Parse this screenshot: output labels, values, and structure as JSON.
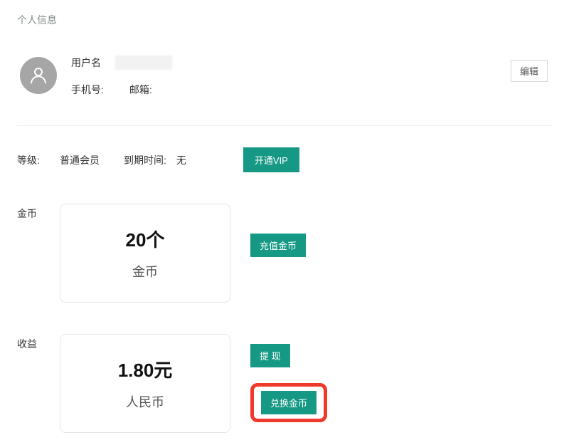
{
  "pageTitle": "个人信息",
  "profile": {
    "usernameLabel": "用户名",
    "phoneLabel": "手机号:",
    "emailLabel": "邮箱:",
    "editLabel": "编辑"
  },
  "level": {
    "label": "等级:",
    "value": "普通会员",
    "expireLabel": "到期时间:",
    "expireValue": "无",
    "vipButton": "开通VIP"
  },
  "coins": {
    "label": "金币",
    "cardNumber": "20个",
    "cardUnit": "金币",
    "rechargeButton": "充值金币"
  },
  "earnings": {
    "label": "收益",
    "cardNumber": "1.80元",
    "cardUnit": "人民币",
    "withdrawButton": "提 现",
    "exchangeButton": "兑换金币"
  }
}
